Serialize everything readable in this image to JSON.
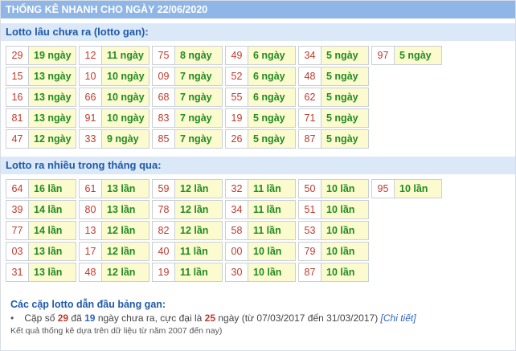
{
  "title": "THỐNG KÊ NHANH CHO NGÀY 22/06/2020",
  "gan": {
    "heading": "Lotto lâu chưa ra (lotto gan):",
    "columns": [
      [
        [
          "29",
          "19 ngày"
        ],
        [
          "15",
          "13 ngày"
        ],
        [
          "16",
          "13 ngày"
        ],
        [
          "81",
          "13 ngày"
        ],
        [
          "47",
          "12 ngày"
        ]
      ],
      [
        [
          "12",
          "11 ngày"
        ],
        [
          "10",
          "10 ngày"
        ],
        [
          "66",
          "10 ngày"
        ],
        [
          "91",
          "10 ngày"
        ],
        [
          "33",
          "9 ngày"
        ]
      ],
      [
        [
          "75",
          "8 ngày"
        ],
        [
          "09",
          "7 ngày"
        ],
        [
          "68",
          "7 ngày"
        ],
        [
          "83",
          "7 ngày"
        ],
        [
          "85",
          "7 ngày"
        ]
      ],
      [
        [
          "49",
          "6 ngày"
        ],
        [
          "52",
          "6 ngày"
        ],
        [
          "55",
          "6 ngày"
        ],
        [
          "19",
          "5 ngày"
        ],
        [
          "26",
          "5 ngày"
        ]
      ],
      [
        [
          "34",
          "5 ngày"
        ],
        [
          "48",
          "5 ngày"
        ],
        [
          "62",
          "5 ngày"
        ],
        [
          "71",
          "5 ngày"
        ],
        [
          "87",
          "5 ngày"
        ]
      ],
      [
        [
          "97",
          "5 ngày"
        ]
      ]
    ]
  },
  "many": {
    "heading": "Lotto ra nhiều trong tháng qua:",
    "columns": [
      [
        [
          "64",
          "16 lần"
        ],
        [
          "39",
          "14 lần"
        ],
        [
          "77",
          "14 lần"
        ],
        [
          "03",
          "13 lần"
        ],
        [
          "31",
          "13 lần"
        ]
      ],
      [
        [
          "61",
          "13 lần"
        ],
        [
          "80",
          "13 lần"
        ],
        [
          "13",
          "12 lần"
        ],
        [
          "17",
          "12 lần"
        ],
        [
          "48",
          "12 lần"
        ]
      ],
      [
        [
          "59",
          "12 lần"
        ],
        [
          "78",
          "12 lần"
        ],
        [
          "82",
          "12 lần"
        ],
        [
          "40",
          "11 lần"
        ],
        [
          "19",
          "11 lần"
        ]
      ],
      [
        [
          "32",
          "11 lần"
        ],
        [
          "34",
          "11 lần"
        ],
        [
          "58",
          "11 lần"
        ],
        [
          "00",
          "10 lần"
        ],
        [
          "30",
          "10 lần"
        ]
      ],
      [
        [
          "50",
          "10 lần"
        ],
        [
          "51",
          "10 lần"
        ],
        [
          "53",
          "10 lần"
        ],
        [
          "79",
          "10 lần"
        ],
        [
          "87",
          "10 lần"
        ]
      ],
      [
        [
          "95",
          "10 lần"
        ]
      ]
    ]
  },
  "summary": {
    "heading": "Các cặp lotto dẫn đầu bảng gan:",
    "text_1": "Cặp số",
    "pair": "29",
    "text_2": "đã",
    "days": "19",
    "text_3": "ngày chưa ra, cực đại là",
    "max": "25",
    "text_4": "ngày (từ 07/03/2017 đến 31/03/2017)",
    "link": "[Chi tiết]",
    "note": "Kết quả thống kê dựa trên dữ liệu từ năm 2007 đến nay)"
  }
}
